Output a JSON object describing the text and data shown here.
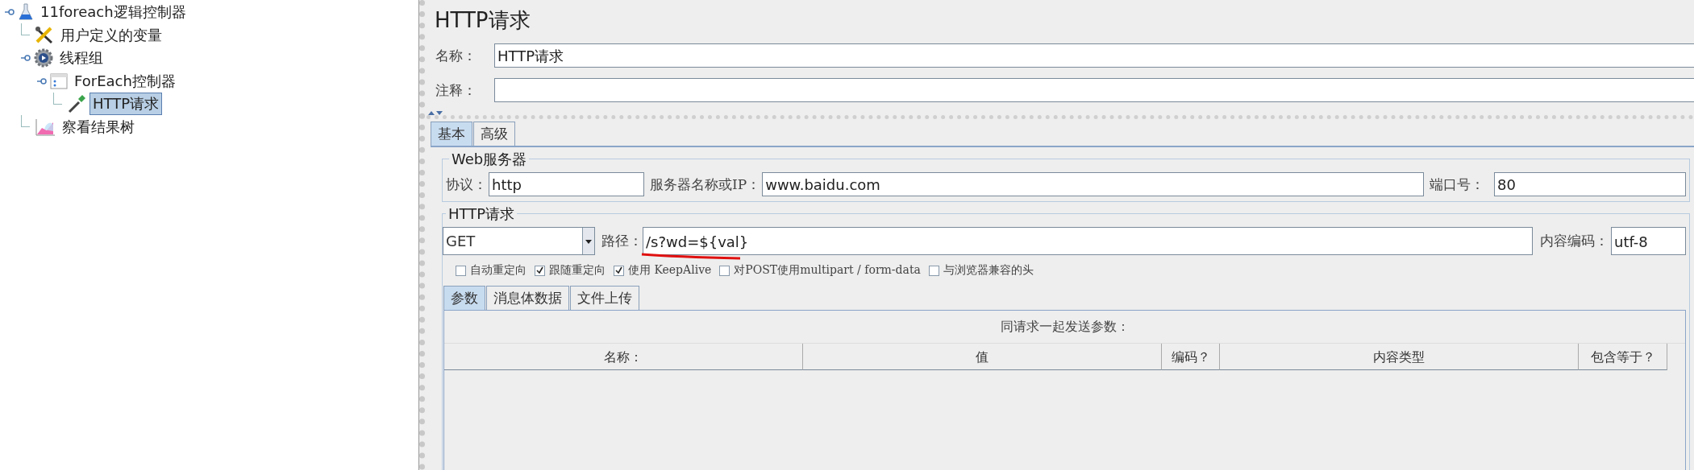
{
  "tree": [
    {
      "label": "11foreach逻辑控制器",
      "kind": "flask",
      "expanded": true,
      "selected": false,
      "children": [
        {
          "label": "用户定义的变量",
          "kind": "tools",
          "expanded": false,
          "selected": false
        },
        {
          "label": "线程组",
          "kind": "gear",
          "expanded": true,
          "selected": false,
          "children": [
            {
              "label": "ForEach控制器",
              "kind": "controller",
              "expanded": true,
              "selected": false,
              "children": [
                {
                  "label": "HTTP请求",
                  "kind": "pipette",
                  "expanded": false,
                  "selected": true
                }
              ]
            }
          ]
        },
        {
          "label": "察看结果树",
          "kind": "chart",
          "expanded": false,
          "selected": false
        }
      ]
    }
  ],
  "panel": {
    "title": "HTTP请求",
    "name_label": "名称：",
    "name_value": "HTTP请求",
    "comment_label": "注释：",
    "tabs": [
      {
        "label": "基本",
        "selected": true
      },
      {
        "label": "高级",
        "selected": false
      }
    ],
    "web_server": {
      "legend": "Web服务器",
      "protocol_label": "协议：",
      "protocol": "http",
      "server_label": "服务器名称或IP：",
      "server": "www.baidu.com",
      "port_label": "端口号：",
      "port": "80"
    },
    "http_request": {
      "legend": "HTTP请求",
      "method": "GET",
      "path_label": "路径：",
      "path": "/s?wd=${val}",
      "encoding_label": "内容编码：",
      "encoding": "utf-8",
      "options": [
        {
          "label": "自动重定向",
          "checked": false
        },
        {
          "label": "跟随重定向",
          "checked": true
        },
        {
          "label": "使用 KeepAlive",
          "checked": true
        },
        {
          "label": "对POST使用multipart / form-data",
          "checked": false
        },
        {
          "label": "与浏览器兼容的头",
          "checked": false
        }
      ]
    },
    "inner_tabs": [
      {
        "label": "参数",
        "selected": true
      },
      {
        "label": "消息体数据",
        "selected": false
      },
      {
        "label": "文件上传",
        "selected": false
      }
    ],
    "table": {
      "caption": "同请求一起发送参数：",
      "columns": [
        "名称：",
        "值",
        "编码？",
        "内容类型",
        "包含等于？"
      ]
    }
  }
}
